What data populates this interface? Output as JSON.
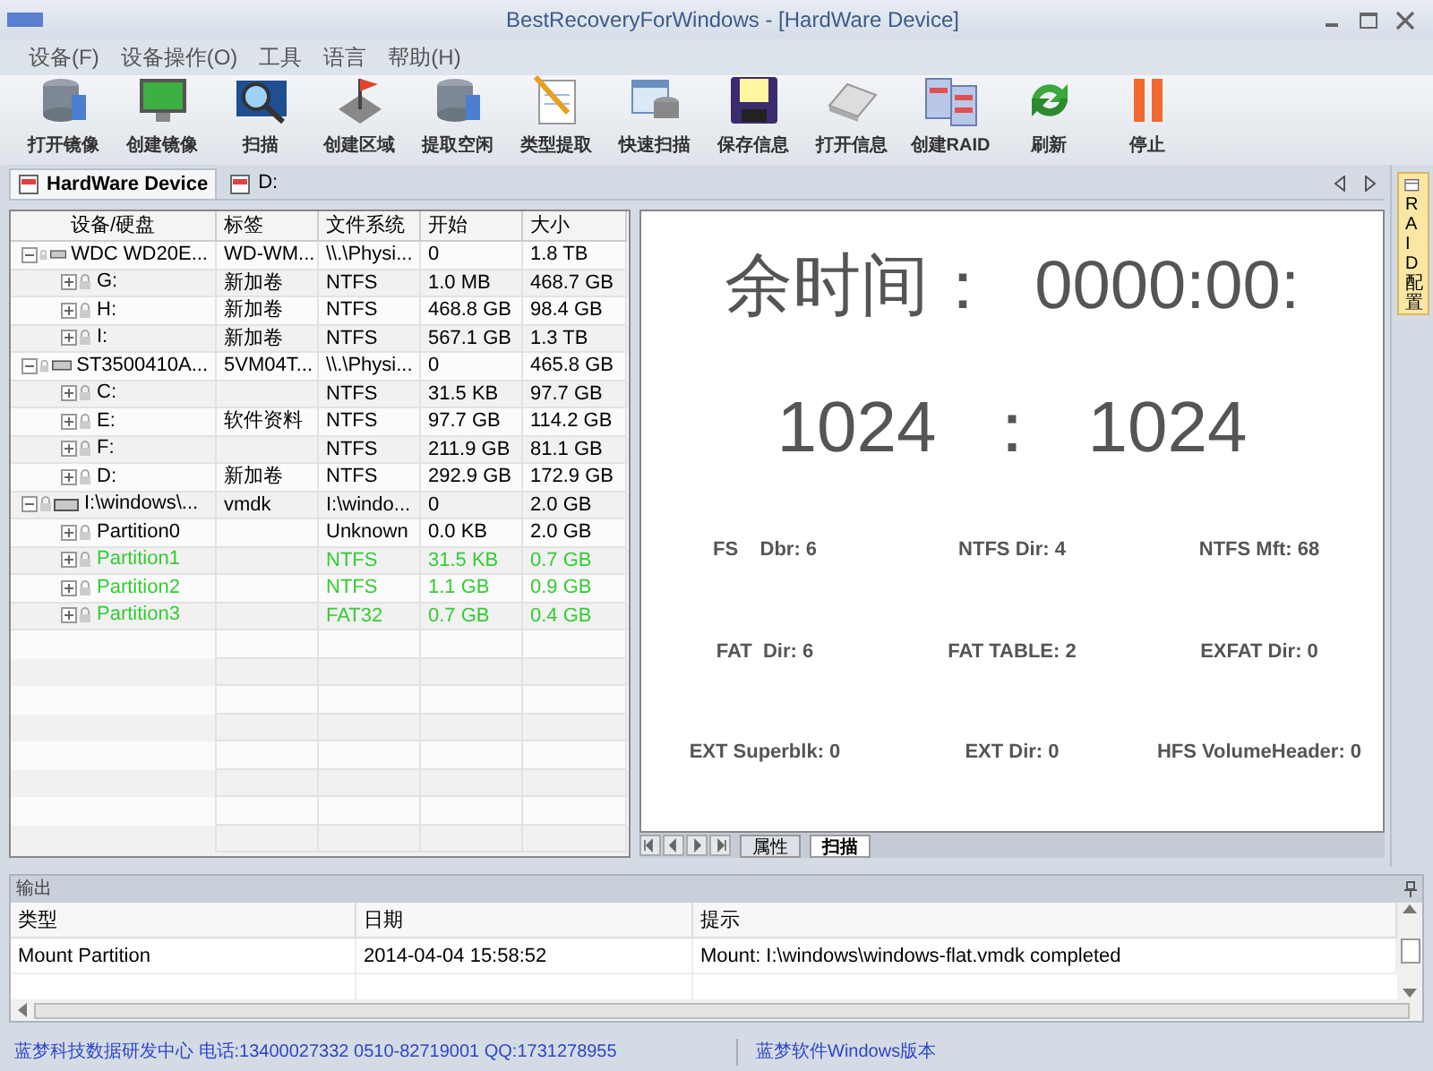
{
  "window": {
    "title": "BestRecoveryForWindows - [HardWare Device]"
  },
  "menu": [
    "设备(F)",
    "设备操作(O)",
    "工具",
    "语言",
    "帮助(H)"
  ],
  "toolbar": [
    {
      "label": "打开镜像",
      "kind": "disk"
    },
    {
      "label": "创建镜像",
      "kind": "monitor"
    },
    {
      "label": "扫描",
      "kind": "scan"
    },
    {
      "label": "创建区域",
      "kind": "flag"
    },
    {
      "label": "提取空闲",
      "kind": "disk"
    },
    {
      "label": "类型提取",
      "kind": "note"
    },
    {
      "label": "快速扫描",
      "kind": "window"
    },
    {
      "label": "保存信息",
      "kind": "floppy"
    },
    {
      "label": "打开信息",
      "kind": "drive"
    },
    {
      "label": "创建RAID",
      "kind": "raid"
    },
    {
      "label": "刷新",
      "kind": "refresh"
    },
    {
      "label": "停止",
      "kind": "stop"
    }
  ],
  "doc_tabs": [
    {
      "label": "HardWare Device",
      "selected": true
    },
    {
      "label": "D:",
      "selected": false
    }
  ],
  "table": {
    "columns": [
      "设备/硬盘",
      "标签",
      "文件系统",
      "开始",
      "大小"
    ],
    "rows": [
      {
        "name": "WDC WD20E...",
        "label": "WD-WM...",
        "fs": "\\\\.\\Physi...",
        "start": "0",
        "size": "1.8 TB",
        "children": [
          {
            "name": "G:",
            "label": "新加卷",
            "fs": "NTFS",
            "start": "1.0 MB",
            "size": "468.7 GB",
            "color": "#000000"
          },
          {
            "name": "H:",
            "label": "新加卷",
            "fs": "NTFS",
            "start": "468.8 GB",
            "size": "98.4 GB",
            "color": "#000000"
          },
          {
            "name": "I:",
            "label": "新加卷",
            "fs": "NTFS",
            "start": "567.1 GB",
            "size": "1.3 TB",
            "color": "#000000"
          }
        ]
      },
      {
        "name": "ST3500410A...",
        "label": "5VM04T...",
        "fs": "\\\\.\\Physi...",
        "start": "0",
        "size": "465.8 GB",
        "children": [
          {
            "name": "C:",
            "fs": "NTFS",
            "start": "31.5 KB",
            "size": "97.7 GB",
            "color": "#000000"
          },
          {
            "name": "E:",
            "label": "软件资料",
            "fs": "NTFS",
            "start": "97.7 GB",
            "size": "114.2 GB",
            "color": "#000000"
          },
          {
            "name": "F:",
            "fs": "NTFS",
            "start": "211.9 GB",
            "size": "81.1 GB",
            "color": "#000000"
          },
          {
            "name": "D:",
            "label": "新加卷",
            "fs": "NTFS",
            "start": "292.9 GB",
            "size": "172.9 GB",
            "color": "#000000"
          }
        ]
      },
      {
        "name": "I:\\windows\\...",
        "label": "vmdk",
        "fs": "I:\\windo...",
        "start": "0",
        "size": "2.0 GB",
        "children": [
          {
            "name": "Partition0",
            "fs": "Unknown",
            "start": "0.0 KB",
            "size": "2.0 GB",
            "color": "#000000"
          },
          {
            "name": "Partition1",
            "fs": "NTFS",
            "start": "31.5 KB",
            "size": "0.7 GB",
            "color": "#33cc33"
          },
          {
            "name": "Partition2",
            "fs": "NTFS",
            "start": "1.1 GB",
            "size": "0.9 GB",
            "color": "#33cc33"
          },
          {
            "name": "Partition3",
            "fs": "FAT32",
            "start": "0.7 GB",
            "size": "0.4 GB",
            "color": "#33cc33"
          }
        ]
      }
    ]
  },
  "scan": {
    "remaining": "余时间：  0000:00:",
    "progress": "1024  ：  1024",
    "stats": [
      "FS    Dbr: 6",
      "NTFS Dir: 4",
      "NTFS Mft: 68",
      "FAT  Dir: 6",
      "FAT TABLE: 2",
      "EXFAT Dir: 0",
      "EXT Superblk: 0",
      "EXT Dir: 0",
      "HFS VolumeHeader: 0"
    ],
    "tabs": [
      {
        "label": "属性",
        "selected": false
      },
      {
        "label": "扫描",
        "selected": true
      }
    ]
  },
  "side_tab": "RAID配置",
  "output": {
    "title": "输出",
    "columns": [
      "类型",
      "日期",
      "提示"
    ],
    "rows": [
      [
        "Mount Partition",
        "2014-04-04 15:58:52",
        "Mount: I:\\windows\\windows-flat.vmdk completed"
      ]
    ]
  },
  "status_bar": [
    "蓝梦科技数据研发中心 电话:13400027332 0510-82719001 QQ:1731278955",
    "蓝梦软件Windows版本"
  ]
}
